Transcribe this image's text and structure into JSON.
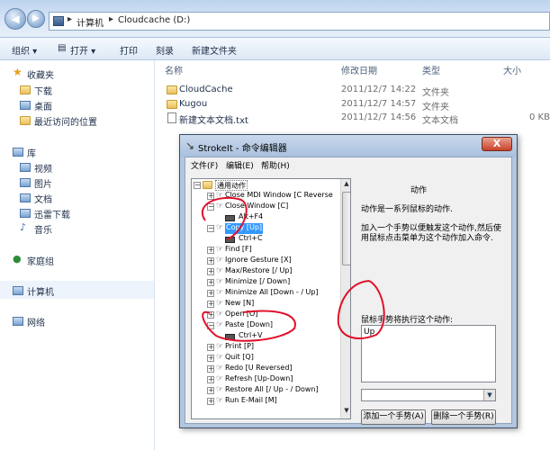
{
  "address": {
    "crumb1": "计算机",
    "crumb2": "Cloudcache (D:)"
  },
  "toolbar": {
    "organize": "组织 ▾",
    "open": "打开 ▾",
    "print": "打印",
    "burn": "刻录",
    "new_folder": "新建文件夹"
  },
  "nav": {
    "favorites": "收藏夹",
    "downloads": "下载",
    "desktop": "桌面",
    "recent": "最近访问的位置",
    "libraries": "库",
    "videos": "视频",
    "pictures": "图片",
    "documents": "文档",
    "thunder": "迅雷下载",
    "music": "音乐",
    "homegroup": "家庭组",
    "computer": "计算机",
    "network": "网络"
  },
  "columns": {
    "name": "名称",
    "modified": "修改日期",
    "type": "类型",
    "size": "大小"
  },
  "files": [
    {
      "name": "CloudCache",
      "date": "2011/12/7 14:22",
      "type": "文件夹",
      "size": ""
    },
    {
      "name": "Kugou",
      "date": "2011/12/7 14:57",
      "type": "文件夹",
      "size": ""
    },
    {
      "name": "新建文本文档.txt",
      "date": "2011/12/7 14:56",
      "type": "文本文档",
      "size": "0 KB"
    }
  ],
  "dialog": {
    "title": "StrokeIt - 命令编辑器",
    "close": "X",
    "menu": {
      "file": "文件(F)",
      "edit": "编辑(E)",
      "help": "帮助(H)"
    },
    "tree": {
      "root": "通用动作",
      "items": [
        "Close MDI Window [C Reverse",
        "Close Window [C]",
        "Alt+F4",
        "Copy [Up]",
        "Ctrl+C",
        "Find [F]",
        "Ignore Gesture [X]",
        "Max/Restore [/ Up]",
        "Minimize [/ Down]",
        "Minimize All [Down - / Up]",
        "New [N]",
        "Open [O]",
        "Paste [Down]",
        "Ctrl+V",
        "Print [P]",
        "Quit [Q]",
        "Redo [U Reversed]",
        "Refresh [Up-Down]",
        "Restore All [/ Up - / Down]",
        "Run E-Mail [M]"
      ]
    },
    "right": {
      "heading": "动作",
      "desc1": "动作是一系列鼠标的动作.",
      "desc2a": "加入一个手势以便触发这个动作,然后使",
      "desc2b": "用鼠标点击菜单为这个动作加入命令.",
      "gesture_label": "鼠标手势将执行这个动作:",
      "gesture_value": "Up",
      "add_button": "添加一个手势(A)",
      "delete_button": "删除一个手势(R)"
    }
  },
  "annotation_color": "#e0102a"
}
